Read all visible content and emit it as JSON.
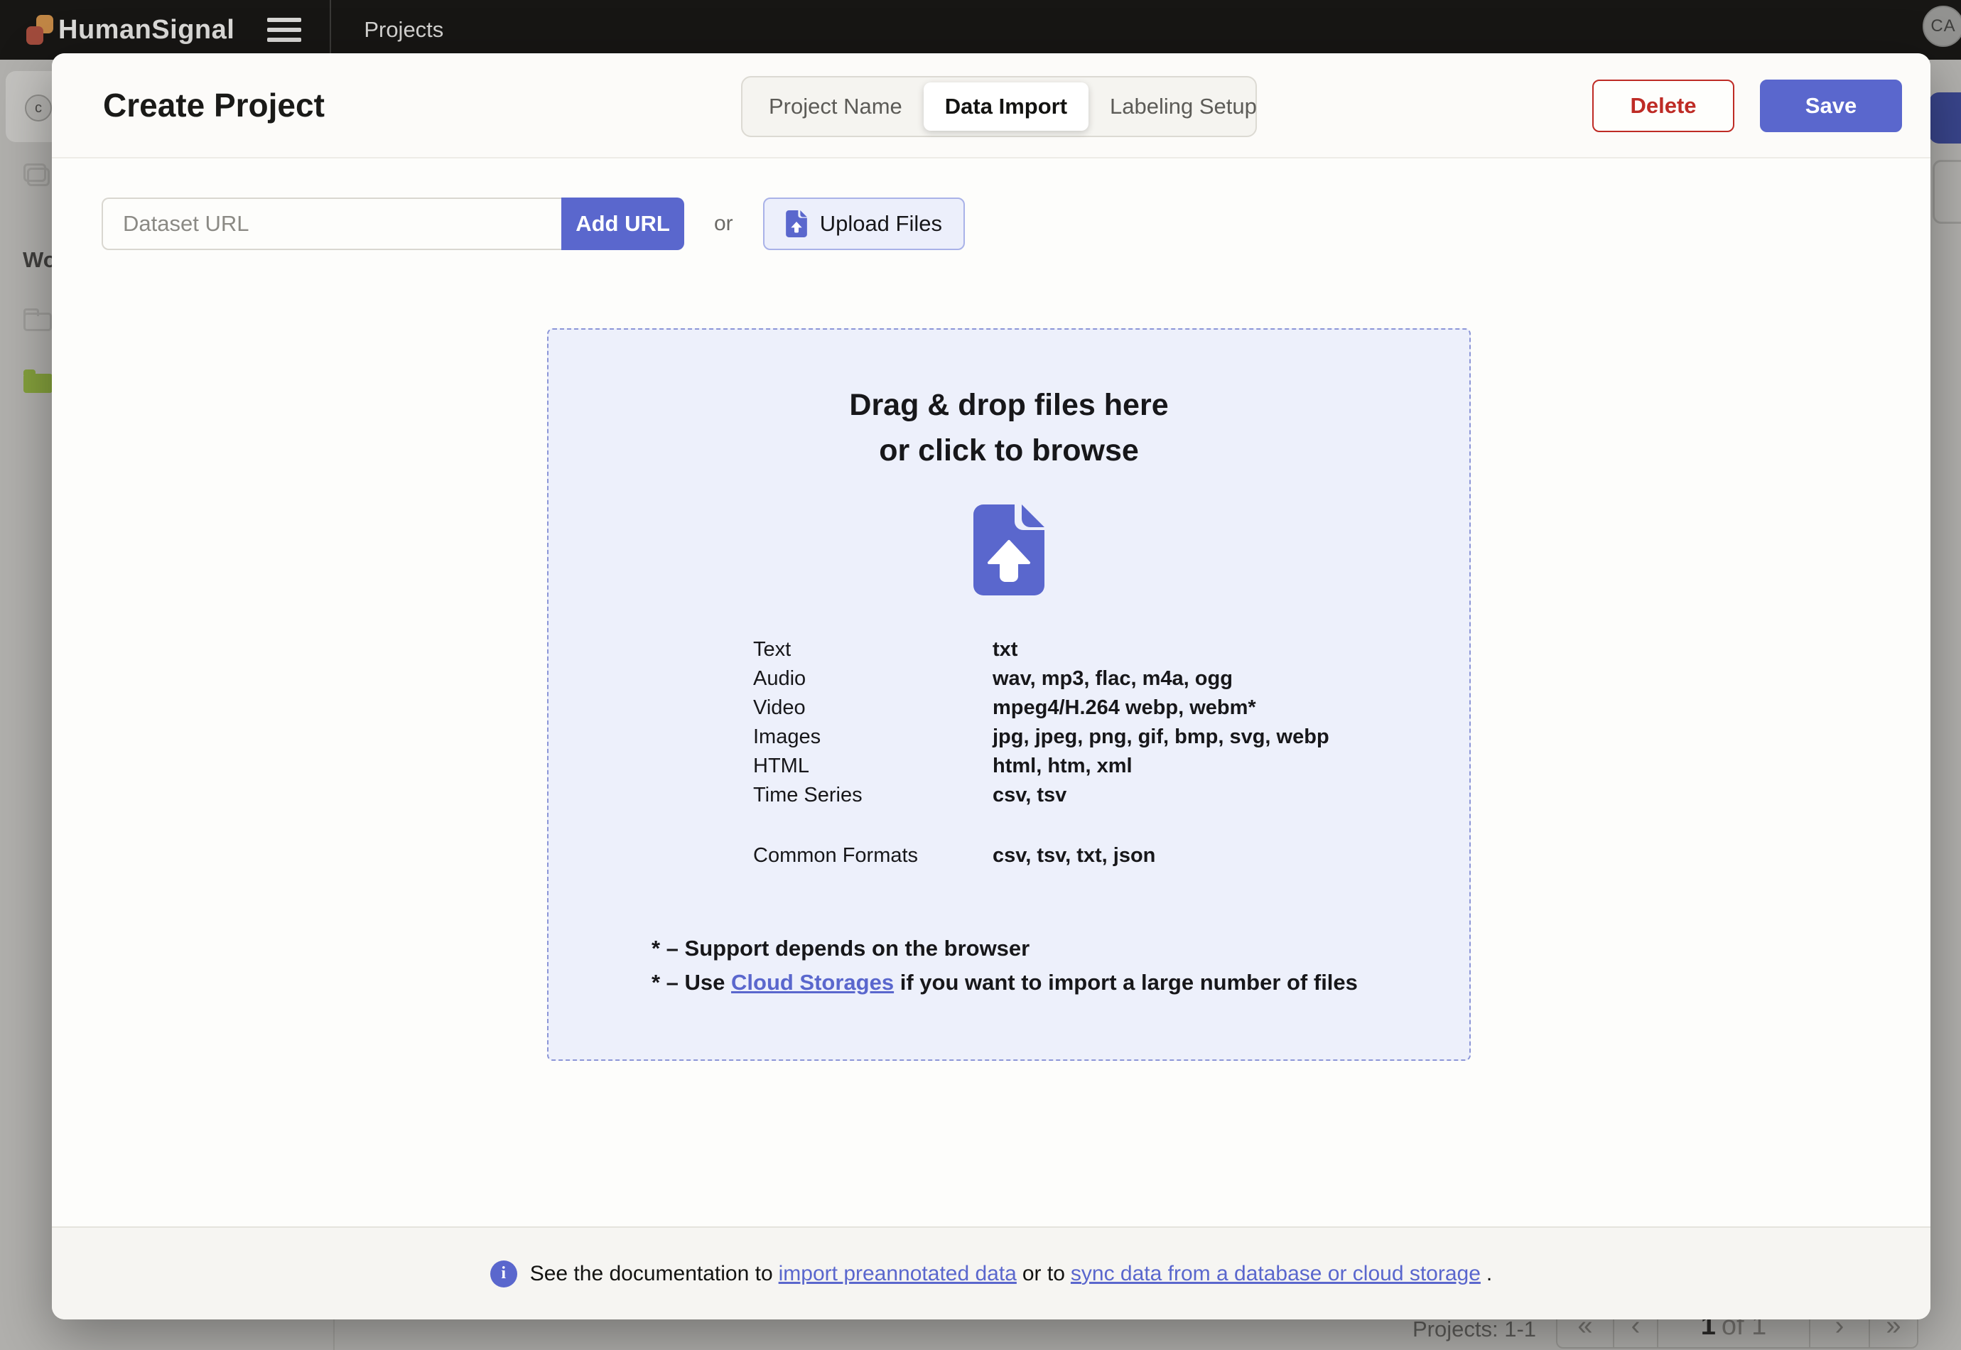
{
  "topbar": {
    "brand": "HumanSignal",
    "nav_title": "Projects",
    "avatar_initials": "CA"
  },
  "modal": {
    "title": "Create Project",
    "tabs": [
      {
        "label": "Project Name"
      },
      {
        "label": "Data Import"
      },
      {
        "label": "Labeling Setup"
      }
    ],
    "delete_label": "Delete",
    "save_label": "Save",
    "url_input": {
      "placeholder": "Dataset URL",
      "value": ""
    },
    "add_url_label": "Add URL",
    "or_label": "or",
    "upload_files_label": "Upload Files",
    "dropzone": {
      "headline_line1": "Drag & drop files here",
      "headline_line2": "or click to browse",
      "formats": [
        {
          "category": "Text",
          "extensions": "txt"
        },
        {
          "category": "Audio",
          "extensions": "wav, mp3, flac, m4a, ogg"
        },
        {
          "category": "Video",
          "extensions": "mpeg4/H.264 webp, webm*"
        },
        {
          "category": "Images",
          "extensions": "jpg, jpeg, png, gif, bmp, svg, webp"
        },
        {
          "category": "HTML",
          "extensions": "html, htm, xml"
        },
        {
          "category": "Time Series",
          "extensions": "csv, tsv"
        }
      ],
      "common": {
        "category": "Common Formats",
        "extensions": "csv, tsv, txt, json"
      },
      "note1": "* – Support depends on the browser",
      "note2_prefix": "* – Use ",
      "note2_link": "Cloud Storages",
      "note2_suffix": " if you want to import a large number of files"
    },
    "footer": {
      "text_prefix": "See the documentation to ",
      "link1": "import preannotated data",
      "text_middle": " or to ",
      "link2": "sync data from a database or cloud storage",
      "text_suffix": "."
    }
  },
  "background": {
    "workspace_avatar_letter": "c",
    "workspaces_label_clipped": "Wo",
    "pagination": {
      "summary": "Projects: 1-1",
      "first_glyph": "«",
      "prev_glyph": "‹",
      "page_current": "1",
      "page_of": "of 1",
      "next_glyph": "›",
      "last_glyph": "»"
    }
  },
  "colors": {
    "accent": "#5a67cd",
    "danger": "#be2b25",
    "dropzone_bg": "#edf0fb",
    "folder_green": "#84a03c",
    "topbar_bg": "#171614"
  }
}
